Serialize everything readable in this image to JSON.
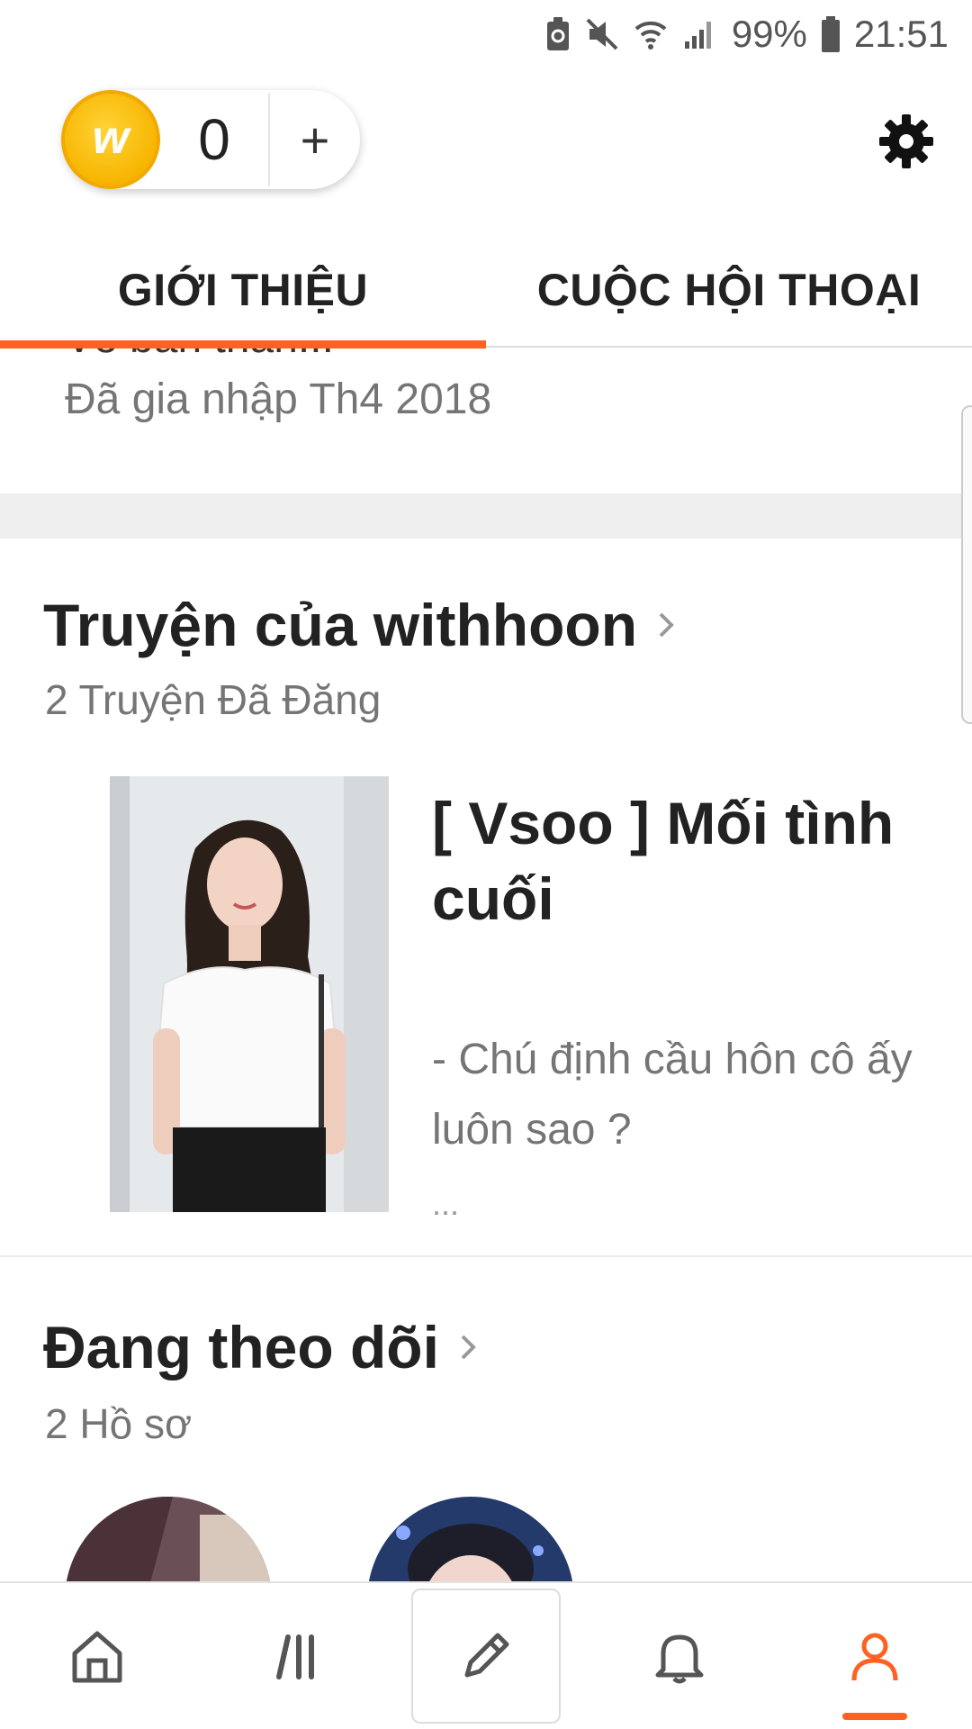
{
  "status_bar": {
    "battery_pct": "99%",
    "time": "21:51",
    "icons": [
      "recycle-battery-icon",
      "mute-icon",
      "wifi-icon",
      "signal-icon",
      "battery-icon"
    ]
  },
  "header": {
    "coin_count": "0",
    "add_label": "+",
    "coin_letter": "w",
    "icons": [
      "coin-icon",
      "settings-gear-icon"
    ]
  },
  "tabs": [
    {
      "label": "GIỚI THIỆU",
      "active": true
    },
    {
      "label": "CUỘC HỘI THOẠI",
      "active": false
    }
  ],
  "about": {
    "cut_off_text": "Về bản thân...",
    "joined": "Đã gia nhập Th4 2018"
  },
  "stories_section": {
    "title": "Truyện của withhoon",
    "subtitle": "2 Truyện Đã Đăng",
    "story": {
      "title": "[ Vsoo ] Mối tình cuối",
      "description": "- Chú định cầu hôn cô ấy luôn sao ?",
      "ellipsis": "..."
    }
  },
  "following_section": {
    "title": "Đang theo dõi",
    "subtitle": "2 Hồ sơ"
  },
  "bottom_nav": {
    "items": [
      "home-icon",
      "library-icon",
      "write-pencil-icon",
      "notifications-bell-icon",
      "profile-icon"
    ],
    "active": "profile-icon"
  },
  "colors": {
    "accent": "#ff6122",
    "coin_gold": "#f7b500",
    "text_primary": "#222222",
    "text_secondary": "#757575"
  }
}
